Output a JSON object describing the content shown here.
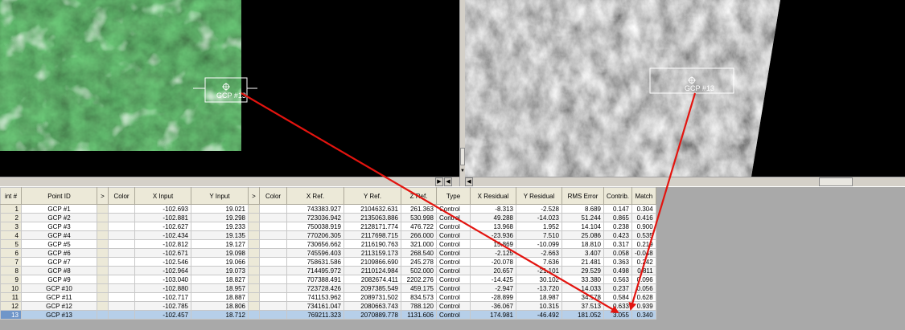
{
  "viewer_left": {
    "gcp_label": "GCP #13"
  },
  "viewer_right": {
    "gcp_label": "GCP #13"
  },
  "scroll_arrows": {
    "up": "▲",
    "down": "▼",
    "left": "◀",
    "right": "▶"
  },
  "table": {
    "columns": [
      "int #",
      "Point ID",
      ">",
      "Color",
      "X Input",
      "Y Input",
      ">",
      "Color",
      "X Ref.",
      "Y Ref.",
      "Z Ref.",
      "Type",
      "X Residual",
      "Y Residual",
      "RMS Error",
      "Contrib.",
      "Match"
    ],
    "rows": [
      [
        "1",
        "GCP #1",
        "",
        "",
        "-102.693",
        "19.021",
        "",
        "",
        "743383.927",
        "2104632.631",
        "261.363",
        "Control",
        "-8.313",
        "-2.528",
        "8.689",
        "0.147",
        "0.304"
      ],
      [
        "2",
        "GCP #2",
        "",
        "",
        "-102.881",
        "19.298",
        "",
        "",
        "723036.942",
        "2135063.886",
        "530.998",
        "Control",
        "49.288",
        "-14.023",
        "51.244",
        "0.865",
        "0.416"
      ],
      [
        "3",
        "GCP #3",
        "",
        "",
        "-102.627",
        "19.233",
        "",
        "",
        "750038.919",
        "2128171.774",
        "476.722",
        "Control",
        "13.968",
        "1.952",
        "14.104",
        "0.238",
        "0.900"
      ],
      [
        "4",
        "GCP #4",
        "",
        "",
        "-102.434",
        "19.135",
        "",
        "",
        "770206.305",
        "2117698.715",
        "266.000",
        "Control",
        "-23.936",
        "7.510",
        "25.086",
        "0.423",
        "0.535"
      ],
      [
        "5",
        "GCP #5",
        "",
        "",
        "-102.812",
        "19.127",
        "",
        "",
        "730656.662",
        "2116190.763",
        "321.000",
        "Control",
        "15.869",
        "-10.099",
        "18.810",
        "0.317",
        "0.219"
      ],
      [
        "6",
        "GCP #6",
        "",
        "",
        "-102.671",
        "19.098",
        "",
        "",
        "745596.403",
        "2113159.173",
        "268.540",
        "Control",
        "-2.125",
        "-2.663",
        "3.407",
        "0.058",
        "-0.048"
      ],
      [
        "7",
        "GCP #7",
        "",
        "",
        "-102.546",
        "19.066",
        "",
        "",
        "758631.586",
        "2109866.690",
        "245.278",
        "Control",
        "-20.078",
        "7.636",
        "21.481",
        "0.363",
        "0.242"
      ],
      [
        "8",
        "GCP #8",
        "",
        "",
        "-102.964",
        "19.073",
        "",
        "",
        "714495.972",
        "2110124.984",
        "502.000",
        "Control",
        "20.657",
        "-21.101",
        "29.529",
        "0.498",
        "0.811"
      ],
      [
        "9",
        "GCP #9",
        "",
        "",
        "-103.040",
        "18.827",
        "",
        "",
        "707388.491",
        "2082674.411",
        "2202.276",
        "Control",
        "-14.425",
        "30.102",
        "33.380",
        "0.563",
        "0.096"
      ],
      [
        "10",
        "GCP #10",
        "",
        "",
        "-102.880",
        "18.957",
        "",
        "",
        "723728.426",
        "2097385.549",
        "459.175",
        "Control",
        "-2.947",
        "-13.720",
        "14.033",
        "0.237",
        "0.056"
      ],
      [
        "11",
        "GCP #11",
        "",
        "",
        "-102.717",
        "18.887",
        "",
        "",
        "741153.962",
        "2089731.502",
        "834.573",
        "Control",
        "-28.899",
        "18.987",
        "34.578",
        "0.584",
        "0.628"
      ],
      [
        "12",
        "GCP #12",
        "",
        "",
        "-102.785",
        "18.806",
        "",
        "",
        "734161.047",
        "2080663.743",
        "788.120",
        "Control",
        "-36.067",
        "10.315",
        "37.513",
        "0.633",
        "0.939"
      ],
      [
        "13",
        "GCP #13",
        "",
        "",
        "-102.457",
        "18.712",
        "",
        "",
        "769211.323",
        "2070889.778",
        "1131.606",
        "Control",
        "174.981",
        "-46.492",
        "181.052",
        "3.055",
        "0.340"
      ]
    ],
    "selected_row": 13
  },
  "colors": {
    "arrow": "#e3140f",
    "selected_row": "#b6cfe9",
    "header": "#ece9d8"
  }
}
